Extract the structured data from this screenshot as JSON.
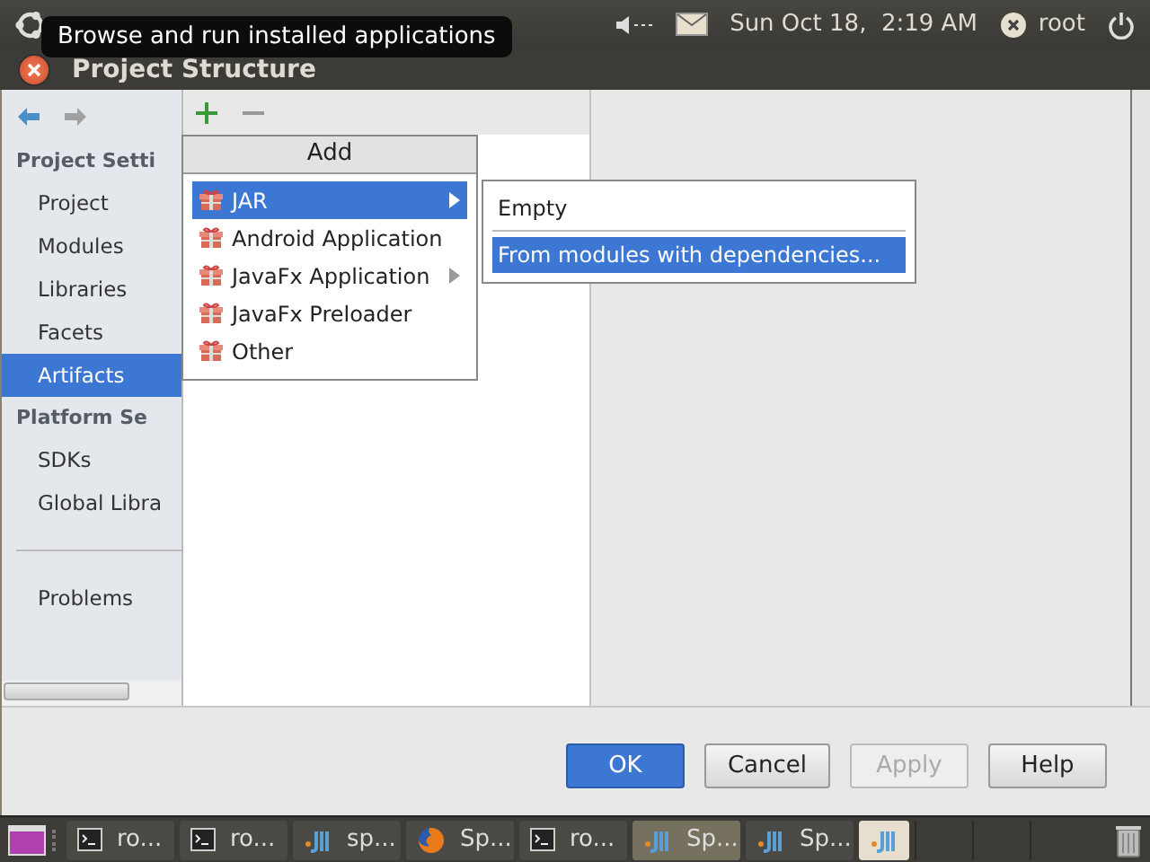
{
  "tooltip": "Browse and run installed applications",
  "panel": {
    "clock": "Sun Oct 18,  2:19 AM",
    "user": "root"
  },
  "window": {
    "title": "Project Structure"
  },
  "sidebar": {
    "sections": [
      {
        "heading": "Project Setti",
        "items": [
          {
            "label": "Project",
            "selected": false
          },
          {
            "label": "Modules",
            "selected": false
          },
          {
            "label": "Libraries",
            "selected": false
          },
          {
            "label": "Facets",
            "selected": false
          },
          {
            "label": "Artifacts",
            "selected": true
          }
        ]
      },
      {
        "heading": "Platform Se",
        "items": [
          {
            "label": "SDKs",
            "selected": false
          },
          {
            "label": "Global Libra",
            "selected": false
          }
        ]
      }
    ],
    "extra": [
      {
        "label": "Problems",
        "selected": false
      }
    ]
  },
  "add_menu": {
    "title": "Add",
    "items": [
      {
        "label": "JAR",
        "selected": true,
        "submenu": true
      },
      {
        "label": "Android Application",
        "selected": false,
        "submenu": false
      },
      {
        "label": "JavaFx Application",
        "selected": false,
        "submenu": true
      },
      {
        "label": "JavaFx Preloader",
        "selected": false,
        "submenu": false
      },
      {
        "label": "Other",
        "selected": false,
        "submenu": false
      }
    ]
  },
  "submenu": {
    "items": [
      {
        "label": "Empty",
        "selected": false
      },
      {
        "label": "From modules with dependencies...",
        "selected": true
      }
    ]
  },
  "buttons": [
    {
      "label": "OK",
      "kind": "default",
      "disabled": false
    },
    {
      "label": "Cancel",
      "kind": "normal",
      "disabled": false
    },
    {
      "label": "Apply",
      "kind": "normal",
      "disabled": true
    },
    {
      "label": "Help",
      "kind": "normal",
      "disabled": false
    }
  ],
  "taskbar": [
    {
      "kind": "terminal",
      "label": "ro...",
      "selected": false
    },
    {
      "kind": "terminal",
      "label": "ro...",
      "selected": false
    },
    {
      "kind": "idea",
      "label": "sp...",
      "selected": false
    },
    {
      "kind": "firefox",
      "label": "Sp...",
      "selected": false
    },
    {
      "kind": "terminal",
      "label": "ro...",
      "selected": false
    },
    {
      "kind": "idea",
      "label": "Sp...",
      "selected": true
    },
    {
      "kind": "idea",
      "label": "Sp...",
      "selected": false
    },
    {
      "kind": "idea",
      "selected": false
    }
  ]
}
